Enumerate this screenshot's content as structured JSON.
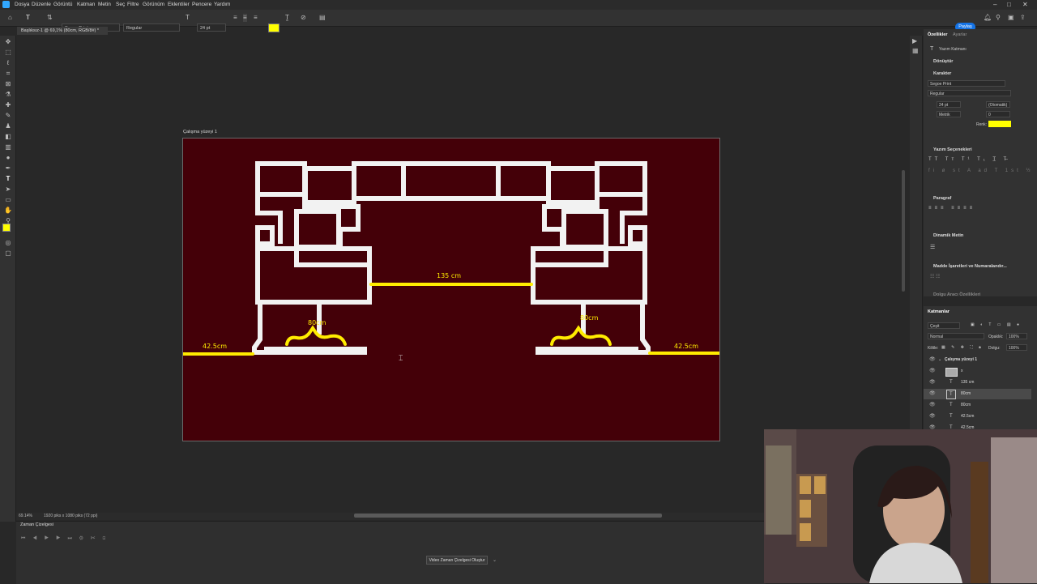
{
  "menu": [
    "Dosya",
    "Düzenle",
    "Görüntü",
    "Katman",
    "Metin",
    "Seç",
    "Filtre",
    "Görünüm",
    "Eklentiler",
    "Pencere",
    "Yardım"
  ],
  "options": {
    "font_family": "Segoe Print",
    "font_style": "Regular",
    "font_size": "24 pt",
    "color": "#ffff00",
    "share_label": "Paylaş"
  },
  "document": {
    "tab_title": "Başlıksız-1 @ 69,1% (80cm, RGB/8#) *",
    "artboard_label": "Çalışma yüzeyi 1",
    "background": "#440008",
    "labels": {
      "center": "135 cm",
      "left_inner": "80cm",
      "right_inner": "80cm",
      "left_outer": "42.5cm",
      "right_outer": "42.5cm"
    }
  },
  "status": {
    "zoom": "69.14%",
    "doc_size": "1920 piks x 1080 piks (72 ppi)"
  },
  "timeline": {
    "title": "Zaman Çizelgesi",
    "create_button": "Video Zaman Çizelgesi Oluştur"
  },
  "properties": {
    "tabs": [
      "Özellikler",
      "Ayarlar"
    ],
    "type_label": "Yazım Katmanı",
    "sections": {
      "transform": "Dönüştür",
      "character": "Karakter",
      "type_options": "Yazım Seçenekleri",
      "paragraph": "Paragraf",
      "smart_text": "Dinamik Metin",
      "bullets": "Madde İşaretleri ve Numaralandır...",
      "more": "Dolgu Aracı Özellikleri"
    },
    "font": "Segoe Print",
    "style": "Regular",
    "size": "24 pt",
    "leading": "(Otomatik)",
    "kerning": "Metrik",
    "tracking": "0",
    "color_label": "Renk:"
  },
  "layers": {
    "title": "Katmanlar",
    "filter": "Çeşit",
    "blend": "Normal",
    "opacity_label": "Opaklık:",
    "opacity": "100%",
    "lock_label": "Kilitle:",
    "fill_label": "Dolgu:",
    "fill": "100%",
    "items": [
      {
        "name": "Çalışma yüzeyi 1",
        "type": "group"
      },
      {
        "name": "x",
        "type": "image"
      },
      {
        "name": "135 cm",
        "type": "text"
      },
      {
        "name": "80cm",
        "type": "text"
      },
      {
        "name": "80cm",
        "type": "text"
      },
      {
        "name": "42.5cm",
        "type": "text"
      },
      {
        "name": "42.5cm",
        "type": "text"
      }
    ]
  }
}
